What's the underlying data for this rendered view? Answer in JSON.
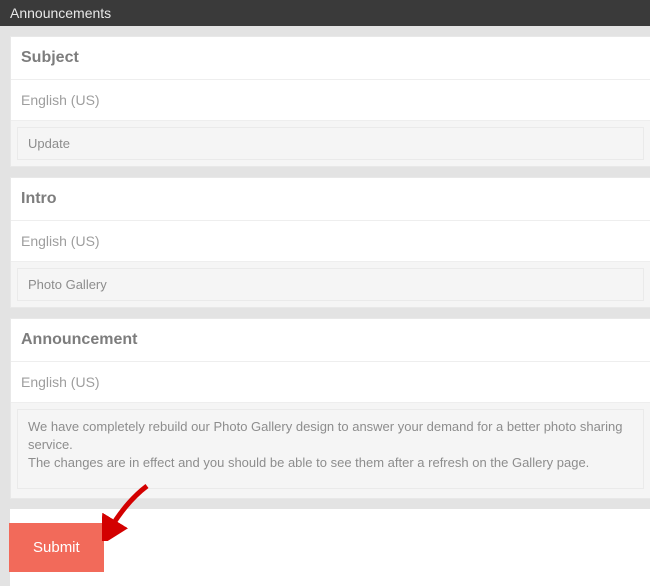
{
  "topbar": {
    "title": "Announcements"
  },
  "subject": {
    "header": "Subject",
    "lang": "English (US)",
    "value": "Update"
  },
  "intro": {
    "header": "Intro",
    "lang": "English (US)",
    "value": "Photo Gallery"
  },
  "announcement": {
    "header": "Announcement",
    "lang": "English (US)",
    "value": "We have completely rebuild our Photo Gallery design to answer your demand for a better photo sharing service.\nThe changes are in effect and you should be able to see them after a refresh on the Gallery page."
  },
  "actions": {
    "submit_label": "Submit"
  }
}
